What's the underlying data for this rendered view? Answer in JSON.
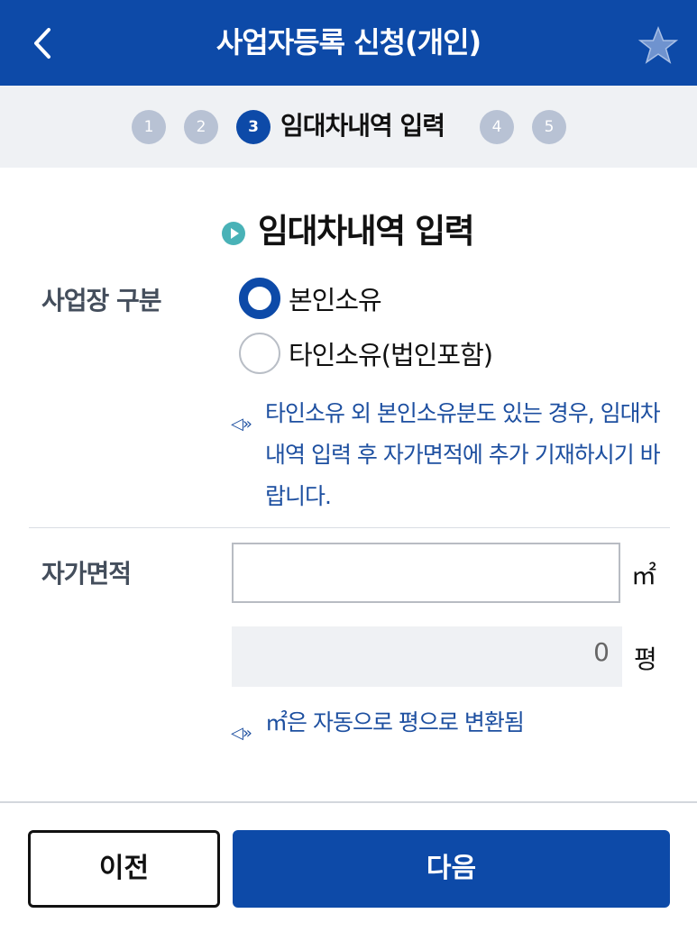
{
  "header": {
    "title": "사업자등록 신청(개인)",
    "back_icon": "chevron-left-icon",
    "favorite_icon": "star-icon"
  },
  "steps": {
    "items": [
      "1",
      "2",
      "3",
      "4",
      "5"
    ],
    "current_index": 3,
    "current_label": "임대차내역 입력"
  },
  "section": {
    "title": "임대차내역 입력"
  },
  "business_place": {
    "label": "사업장 구분",
    "options": [
      "본인소유",
      "타인소유(법인포함)"
    ],
    "selected": "본인소유",
    "note": "타인소유 외 본인소유분도 있는 경우, 임대차내역 입력 후 자가면적에 추가 기재하시기 바랍니다."
  },
  "own_area": {
    "label": "자가면적",
    "value": "",
    "unit_m2": "㎡",
    "pyeong_value": "0",
    "unit_pyeong": "평",
    "note": "㎡은 자동으로 평으로 변환됨"
  },
  "footer": {
    "prev_label": "이전",
    "next_label": "다음"
  },
  "colors": {
    "primary": "#0d4aa8",
    "accent_teal": "#49b2b7",
    "inactive_step": "#b8c2d4",
    "note_text": "#1d4fa0"
  }
}
